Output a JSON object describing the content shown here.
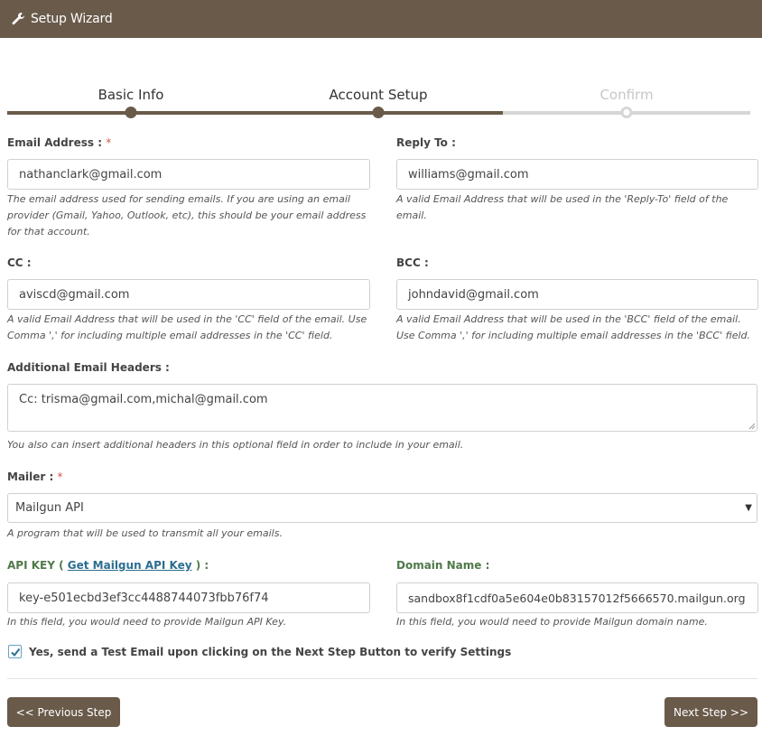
{
  "header": {
    "title": "Setup Wizard",
    "icon": "wrench-icon",
    "bg_color": "#6a5a4a"
  },
  "steps": [
    {
      "label": "Basic Info",
      "state": "done"
    },
    {
      "label": "Account Setup",
      "state": "current"
    },
    {
      "label": "Confirm",
      "state": "pending"
    }
  ],
  "form": {
    "email": {
      "label": "Email Address :",
      "required": "*",
      "value": "nathanclark@gmail.com",
      "help": "The email address used for sending emails. If you are using an email provider (Gmail, Yahoo, Outlook, etc), this should be your email address for that account."
    },
    "reply_to": {
      "label": "Reply To :",
      "value": "williams@gmail.com",
      "help": "A valid Email Address that will be used in the 'Reply-To' field of the email."
    },
    "cc": {
      "label": "CC :",
      "value": "aviscd@gmail.com",
      "help": "A valid Email Address that will be used in the 'CC' field of the email. Use Comma ',' for including multiple email addresses in the 'CC' field."
    },
    "bcc": {
      "label": "BCC :",
      "value": "johndavid@gmail.com",
      "help": "A valid Email Address that will be used in the 'BCC' field of the email. Use Comma ',' for including multiple email addresses in the 'BCC' field."
    },
    "headers": {
      "label": "Additional Email Headers :",
      "value": "Cc: trisma@gmail.com,michal@gmail.com",
      "help": "You also can insert additional headers in this optional field in order to include in your email."
    },
    "mailer": {
      "label": "Mailer :",
      "required": "*",
      "value": "Mailgun API",
      "help": "A program that will be used to transmit all your emails."
    },
    "api_key": {
      "label_prefix": "API KEY (",
      "link_text": "Get Mailgun API Key",
      "label_suffix": ") :",
      "value": "key-e501ecbd3ef3cc4488744073fbb76f74",
      "help": "In this field, you would need to provide Mailgun API Key."
    },
    "domain": {
      "label": "Domain Name :",
      "value": "sandbox8f1cdf0a5e604e0b83157012f5666570.mailgun.org",
      "help": "In this field, you would need to provide Mailgun domain name."
    },
    "test_email": {
      "checked": true,
      "label": "Yes, send a Test Email upon clicking on the Next Step Button to verify Settings"
    }
  },
  "buttons": {
    "previous": "<< Previous Step",
    "next": "Next Step >>"
  }
}
